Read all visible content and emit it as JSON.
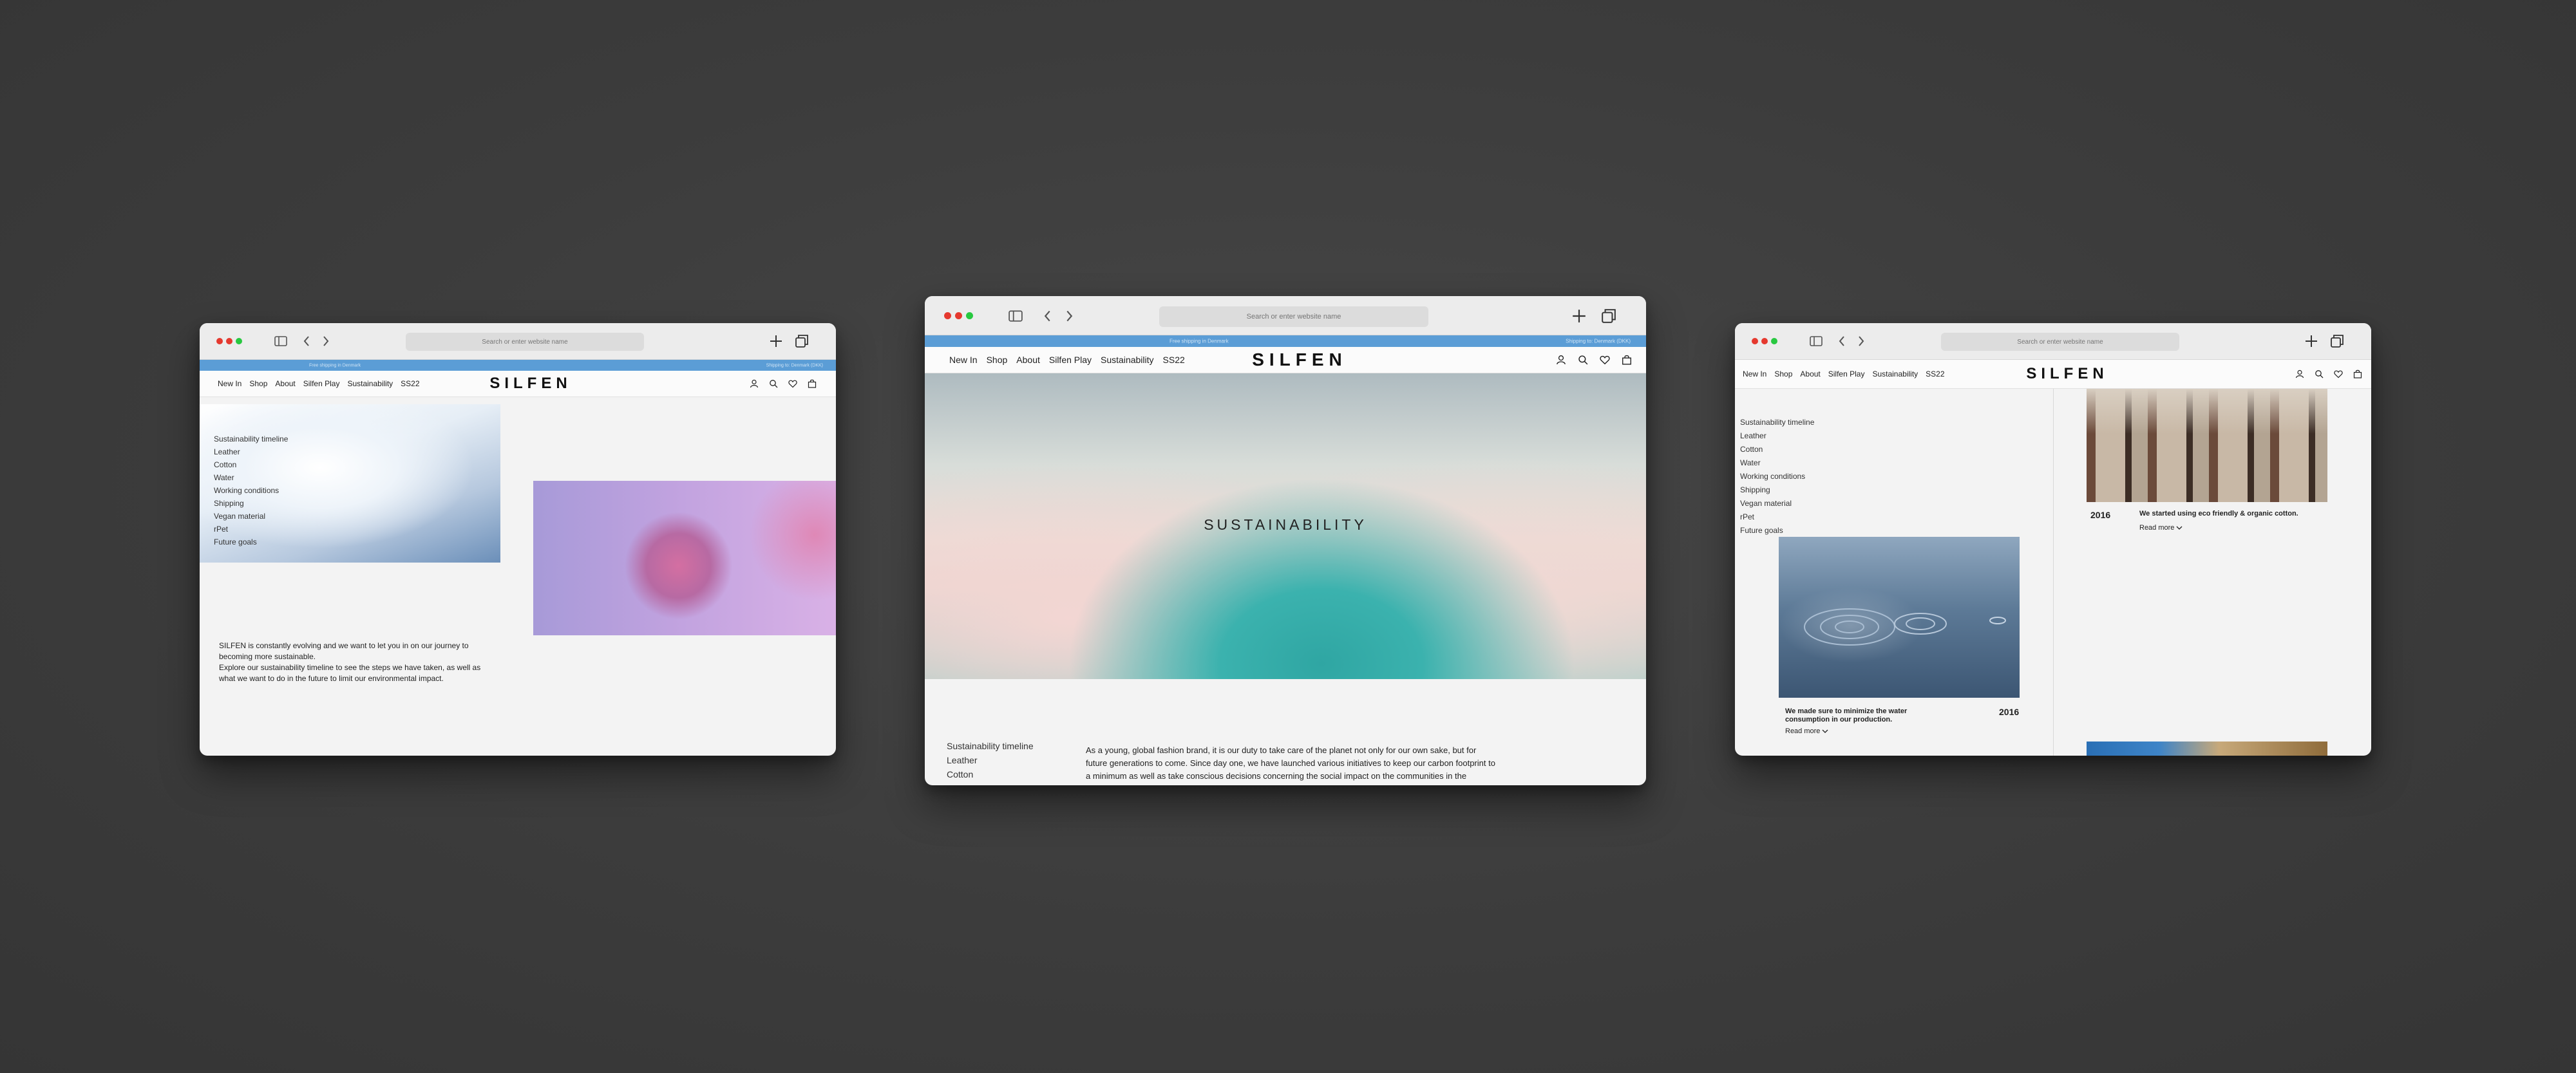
{
  "browser": {
    "url_placeholder": "Search or enter website name"
  },
  "banner": {
    "left": "Free shipping in Denmark",
    "right": "Shipping to: Denmark (DKK)"
  },
  "nav": {
    "links": [
      "New In",
      "Shop",
      "About",
      "Silfen Play",
      "Sustainability",
      "SS22"
    ],
    "logo": "SILFEN"
  },
  "sidebar_items": [
    "Sustainability timeline",
    "Leather",
    "Cotton",
    "Water",
    "Working conditions",
    "Shipping",
    "Vegan material",
    "rPet",
    "Future goals"
  ],
  "left_page": {
    "intro_line1": "SILFEN is constantly evolving and we want to let you in on our journey to",
    "intro_line2": "becoming more sustainable.",
    "intro_line3": "Explore our sustainability timeline to see the steps we have taken, as well as",
    "intro_line4": "what we want to do in the future to limit our environmental impact."
  },
  "center_page": {
    "hero_title": "SUSTAINABILITY",
    "body_line1": "As a young, global fashion brand, it is our duty to take care of the planet not only for our own sake, but for",
    "body_line2": "future generations to come. Since day one, we have launched various initiatives to keep our carbon footprint to",
    "body_line3": "a minimum as well as take conscious decisions concerning the social impact on the communities in the"
  },
  "right_page": {
    "cotton_year": "2016",
    "cotton_text": "We started using eco friendly & organic cotton.",
    "read_more": "Read more",
    "water_text_line1": "We made sure to minimize the water",
    "water_text_line2": "consumption in our production.",
    "water_year": "2016"
  }
}
